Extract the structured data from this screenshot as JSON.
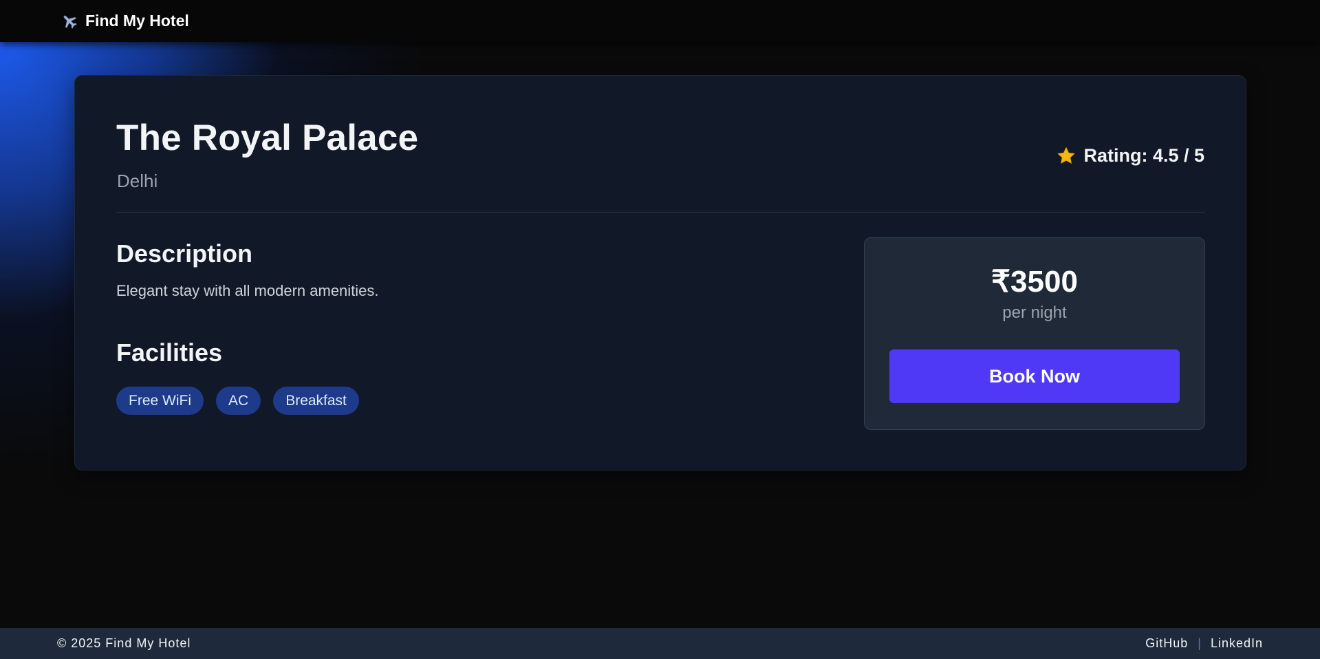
{
  "navbar": {
    "brand": "Find My Hotel",
    "brand_icon": "airplane-icon"
  },
  "hotel": {
    "name": "The Royal Palace",
    "location": "Delhi",
    "rating_text": "Rating: 4.5 / 5",
    "rating_icon": "star-icon",
    "description_heading": "Description",
    "description": "Elegant stay with all modern amenities.",
    "facilities_heading": "Facilities",
    "facilities": [
      "Free WiFi",
      "AC",
      "Breakfast"
    ]
  },
  "booking": {
    "price": "₹3500",
    "per_night": "per night",
    "book_label": "Book Now"
  },
  "footer": {
    "copyright": "© 2025 Find My Hotel",
    "links": [
      "GitHub",
      "LinkedIn"
    ],
    "separator": "|"
  },
  "colors": {
    "background": "#0a0a0a",
    "accent_blue_glow": "#1d5bee",
    "card": "#111827",
    "price_box": "#1f2937",
    "button": "#4f39f6",
    "chip": "#1e3a8a",
    "footer": "#1e293b"
  }
}
